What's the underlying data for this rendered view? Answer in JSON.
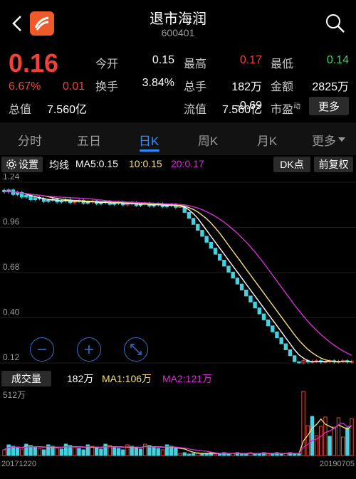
{
  "header": {
    "title": "退市海润",
    "code": "600401"
  },
  "quote": {
    "price": "0.16",
    "pct": "6.67%",
    "change": "0.01",
    "rows": [
      [
        {
          "label": "今开",
          "value": "0.15",
          "color": "#ffffff"
        },
        {
          "label": "最高",
          "value": "0.17",
          "color": "#f2403a"
        },
        {
          "label": "最低",
          "value": "0.14",
          "color": "#3fd26b"
        }
      ],
      [
        {
          "label": "换手",
          "value": "3.84%",
          "color": "#ffffff"
        },
        {
          "label": "总手",
          "value": "182万",
          "color": "#ffffff"
        },
        {
          "label": "金额",
          "value": "2825万",
          "color": "#ffffff"
        }
      ],
      [
        {
          "label": "总值",
          "value": "7.560亿",
          "color": "#ffffff"
        },
        {
          "label": "流值",
          "value": "7.560亿",
          "color": "#ffffff"
        },
        {
          "label": "市盈",
          "sup": "动",
          "value": "-0.69",
          "color": "#ffffff"
        }
      ]
    ],
    "more_label": "更多"
  },
  "tabs": [
    "分时",
    "五日",
    "日K",
    "周K",
    "月K",
    "更多"
  ],
  "active_tab": "日K",
  "kline": {
    "settings_label": "设置",
    "ma_title": "均线",
    "ma5": "MA5:0.15",
    "ma10": "10:0.15",
    "ma20": "20:0.17",
    "dk_label": "DK点",
    "fq_label": "前复权",
    "y_labels": [
      "1.24",
      "0.96",
      "0.68",
      "0.40",
      "0.12"
    ],
    "colors": {
      "ma5": "#ffffff",
      "ma10": "#f5e27a",
      "ma20": "#d42dd0",
      "up": "#f2403a",
      "down": "#45d2e0"
    }
  },
  "volume": {
    "title": "成交量",
    "value": "182万",
    "ma1": "MA1:106万",
    "ma2": "MA2:121万",
    "y_max": "512万",
    "start_date": "20171220",
    "end_date": "20190705"
  },
  "zoom_icons": [
    "zoom-out-icon",
    "zoom-in-icon",
    "fullscreen-icon"
  ]
}
